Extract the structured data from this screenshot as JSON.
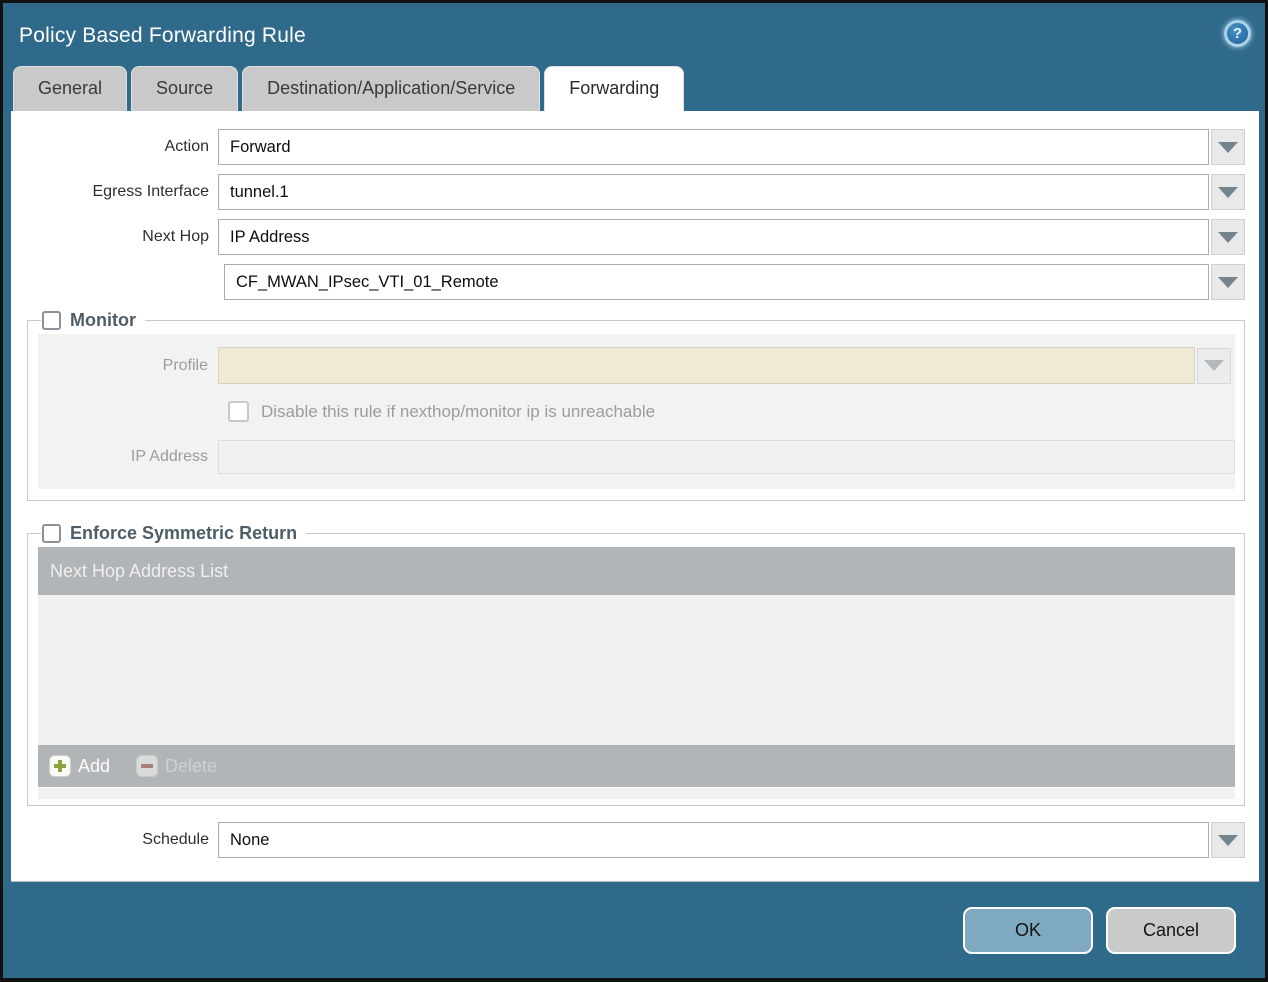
{
  "dialog": {
    "title": "Policy Based Forwarding Rule"
  },
  "tabs": [
    {
      "label": "General",
      "active": false
    },
    {
      "label": "Source",
      "active": false
    },
    {
      "label": "Destination/Application/Service",
      "active": false
    },
    {
      "label": "Forwarding",
      "active": true
    }
  ],
  "form": {
    "action": {
      "label": "Action",
      "value": "Forward"
    },
    "egress_interface": {
      "label": "Egress Interface",
      "value": "tunnel.1"
    },
    "next_hop": {
      "label": "Next Hop",
      "value": "IP Address"
    },
    "next_hop_address": {
      "value": "CF_MWAN_IPsec_VTI_01_Remote"
    },
    "schedule": {
      "label": "Schedule",
      "value": "None"
    }
  },
  "monitor": {
    "legend": "Monitor",
    "checked": false,
    "profile": {
      "label": "Profile",
      "value": ""
    },
    "disable_rule": {
      "label": "Disable this rule if nexthop/monitor ip is unreachable",
      "checked": false
    },
    "ip_address": {
      "label": "IP Address",
      "value": ""
    }
  },
  "symmetric_return": {
    "legend": "Enforce Symmetric Return",
    "checked": false,
    "table": {
      "header": "Next Hop Address List",
      "rows": []
    },
    "add_label": "Add",
    "delete_label": "Delete"
  },
  "footer": {
    "ok_label": "OK",
    "cancel_label": "Cancel"
  },
  "colors": {
    "titlebar_teal": "#306a8b",
    "ok_button": "#7fa9be",
    "cancel_button": "#c9cbcb",
    "table_gray": "#b1b5b7",
    "disabled_field_cream": "#f0e9d6"
  }
}
